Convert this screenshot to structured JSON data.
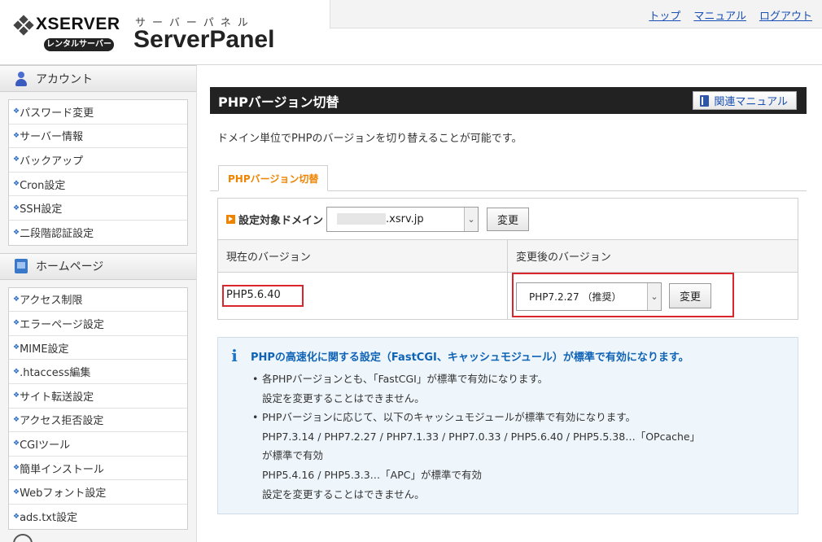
{
  "header": {
    "logo_word": "XSERVER",
    "logo_badge": "レンタルサーバー",
    "logo_sub": "サーバーパネル",
    "logo_title": "ServerPanel",
    "links": [
      "トップ",
      "マニュアル",
      "ログアウト"
    ]
  },
  "sidebar": {
    "sections": [
      {
        "title": "アカウント",
        "icon": "user-icon",
        "items": [
          "パスワード変更",
          "サーバー情報",
          "バックアップ",
          "Cron設定",
          "SSH設定",
          "二段階認証設定"
        ]
      },
      {
        "title": "ホームページ",
        "icon": "home-icon",
        "items": [
          "アクセス制限",
          "エラーページ設定",
          "MIME設定",
          ".htaccess編集",
          "サイト転送設定",
          "アクセス拒否設定",
          "CGIツール",
          "簡単インストール",
          "Webフォント設定",
          "ads.txt設定"
        ]
      }
    ]
  },
  "main": {
    "title": "PHPバージョン切替",
    "manual_button": "関連マニュアル",
    "description": "ドメイン単位でPHPのバージョンを切り替えることが可能です。",
    "tab": "PHPバージョン切替",
    "domain_label": "設定対象ドメイン",
    "domain_value": ".xsrv.jp",
    "domain_change_button": "変更",
    "col_current": "現在のバージョン",
    "col_new": "変更後のバージョン",
    "current_version": "PHP5.6.40",
    "new_version_selected": "PHP7.2.27 （推奨）",
    "version_change_button": "変更",
    "info": {
      "title": "PHPの高速化に関する設定（FastCGI、キャッシュモジュール）が標準で有効になります。",
      "bullet1_line1": "各PHPバージョンとも、「FastCGI」が標準で有効になります。",
      "bullet1_line2": "設定を変更することはできません。",
      "bullet2_line1": "PHPバージョンに応じて、以下のキャッシュモジュールが標準で有効になります。",
      "bullet2_line2": "PHP7.3.14 / PHP7.2.27 / PHP7.1.33 / PHP7.0.33 / PHP5.6.40 / PHP5.5.38…「OPcache」",
      "bullet2_line3": "が標準で有効",
      "bullet2_line4": "PHP5.4.16 / PHP5.3.3…「APC」が標準で有効",
      "bullet2_line5": "設定を変更することはできません。"
    }
  },
  "colors": {
    "title_bar": "#222222",
    "accent_orange": "#f08300",
    "highlight_red": "#d9262c",
    "info_blue": "#0f63b6"
  }
}
